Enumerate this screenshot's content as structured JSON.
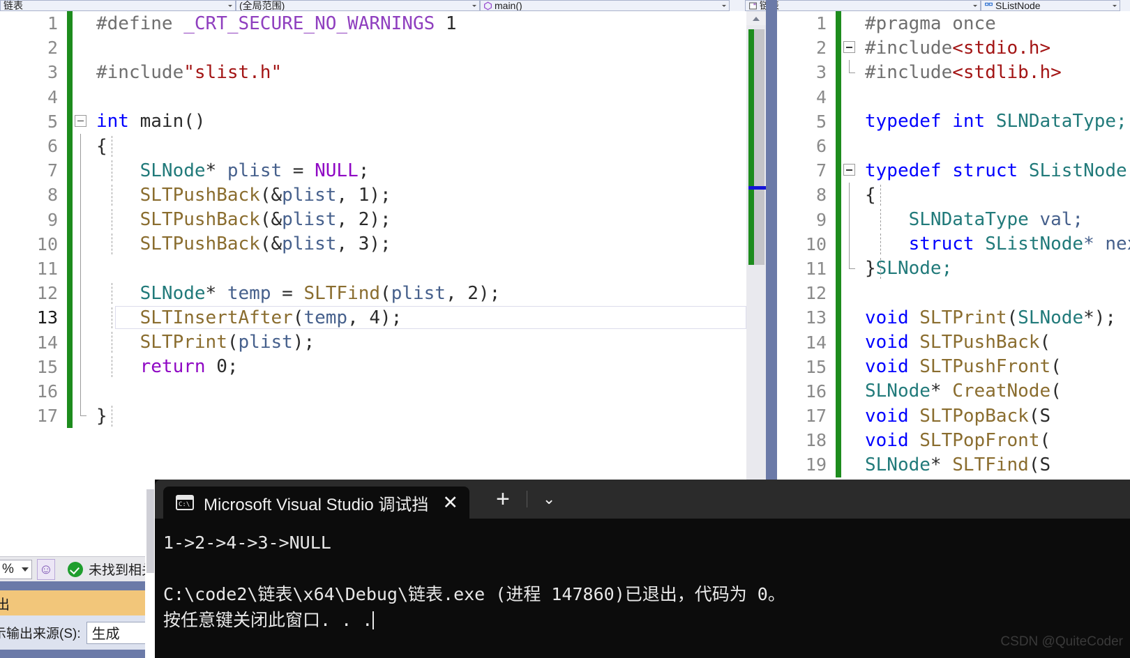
{
  "navbar": {
    "file_combo": {
      "label": "链表",
      "icon": "file-icon"
    },
    "scope_combo": {
      "label": "(全局范围)",
      "icon": "scope-icon"
    },
    "member_combo": {
      "label": "main()",
      "icon": "method-icon"
    },
    "right_file_combo": {
      "label": "链表",
      "icon": "file-icon"
    },
    "right_member_combo": {
      "label": "SListNode",
      "icon": "struct-icon"
    }
  },
  "left_editor": {
    "current_line": 13,
    "lines": [
      {
        "n": 1,
        "tokens": [
          {
            "t": "#define ",
            "c": "t-prep"
          },
          {
            "t": "_CRT_SECURE_NO_WARNINGS",
            "c": "t-macro"
          },
          {
            "t": " 1",
            "c": "t-num"
          }
        ]
      },
      {
        "n": 2,
        "tokens": []
      },
      {
        "n": 3,
        "tokens": [
          {
            "t": "#include",
            "c": "t-prep"
          },
          {
            "t": "\"slist.h\"",
            "c": "t-str"
          }
        ]
      },
      {
        "n": 4,
        "tokens": []
      },
      {
        "n": 5,
        "tokens": [
          {
            "t": "int",
            "c": "t-kw"
          },
          {
            "t": " ",
            "c": "t-plain"
          },
          {
            "t": "main",
            "c": "t-plain"
          },
          {
            "t": "()",
            "c": "t-punc"
          }
        ]
      },
      {
        "n": 6,
        "tokens": [
          {
            "t": "{",
            "c": "t-punc"
          }
        ]
      },
      {
        "n": 7,
        "tokens": [
          {
            "t": "    ",
            "c": "t-plain"
          },
          {
            "t": "SLNode",
            "c": "t-type"
          },
          {
            "t": "* ",
            "c": "t-punc"
          },
          {
            "t": "plist",
            "c": "t-var"
          },
          {
            "t": " = ",
            "c": "t-punc"
          },
          {
            "t": "NULL",
            "c": "t-kwp"
          },
          {
            "t": ";",
            "c": "t-punc"
          }
        ]
      },
      {
        "n": 8,
        "tokens": [
          {
            "t": "    ",
            "c": "t-plain"
          },
          {
            "t": "SLTPushBack",
            "c": "t-fn"
          },
          {
            "t": "(&",
            "c": "t-punc"
          },
          {
            "t": "plist",
            "c": "t-var"
          },
          {
            "t": ", ",
            "c": "t-punc"
          },
          {
            "t": "1",
            "c": "t-num"
          },
          {
            "t": ");",
            "c": "t-punc"
          }
        ]
      },
      {
        "n": 9,
        "tokens": [
          {
            "t": "    ",
            "c": "t-plain"
          },
          {
            "t": "SLTPushBack",
            "c": "t-fn"
          },
          {
            "t": "(&",
            "c": "t-punc"
          },
          {
            "t": "plist",
            "c": "t-var"
          },
          {
            "t": ", ",
            "c": "t-punc"
          },
          {
            "t": "2",
            "c": "t-num"
          },
          {
            "t": ");",
            "c": "t-punc"
          }
        ]
      },
      {
        "n": 10,
        "tokens": [
          {
            "t": "    ",
            "c": "t-plain"
          },
          {
            "t": "SLTPushBack",
            "c": "t-fn"
          },
          {
            "t": "(&",
            "c": "t-punc"
          },
          {
            "t": "plist",
            "c": "t-var"
          },
          {
            "t": ", ",
            "c": "t-punc"
          },
          {
            "t": "3",
            "c": "t-num"
          },
          {
            "t": ");",
            "c": "t-punc"
          }
        ]
      },
      {
        "n": 11,
        "tokens": []
      },
      {
        "n": 12,
        "tokens": [
          {
            "t": "    ",
            "c": "t-plain"
          },
          {
            "t": "SLNode",
            "c": "t-type"
          },
          {
            "t": "* ",
            "c": "t-punc"
          },
          {
            "t": "temp",
            "c": "t-var"
          },
          {
            "t": " = ",
            "c": "t-punc"
          },
          {
            "t": "SLTFind",
            "c": "t-fn"
          },
          {
            "t": "(",
            "c": "t-punc"
          },
          {
            "t": "plist",
            "c": "t-var"
          },
          {
            "t": ", ",
            "c": "t-punc"
          },
          {
            "t": "2",
            "c": "t-num"
          },
          {
            "t": ");",
            "c": "t-punc"
          }
        ]
      },
      {
        "n": 13,
        "tokens": [
          {
            "t": "    ",
            "c": "t-plain"
          },
          {
            "t": "SLTInsertAfter",
            "c": "t-fn"
          },
          {
            "t": "(",
            "c": "t-punc"
          },
          {
            "t": "temp",
            "c": "t-var"
          },
          {
            "t": ", ",
            "c": "t-punc"
          },
          {
            "t": "4",
            "c": "t-num"
          },
          {
            "t": ");",
            "c": "t-punc"
          }
        ]
      },
      {
        "n": 14,
        "tokens": [
          {
            "t": "    ",
            "c": "t-plain"
          },
          {
            "t": "SLTPrint",
            "c": "t-fn"
          },
          {
            "t": "(",
            "c": "t-punc"
          },
          {
            "t": "plist",
            "c": "t-var"
          },
          {
            "t": ");",
            "c": "t-punc"
          }
        ]
      },
      {
        "n": 15,
        "tokens": [
          {
            "t": "    ",
            "c": "t-plain"
          },
          {
            "t": "return",
            "c": "t-kwp"
          },
          {
            "t": " 0;",
            "c": "t-punc"
          }
        ]
      },
      {
        "n": 16,
        "tokens": []
      },
      {
        "n": 17,
        "tokens": [
          {
            "t": "}",
            "c": "t-punc"
          }
        ]
      }
    ]
  },
  "right_editor": {
    "lines": [
      {
        "n": 1,
        "tokens": [
          {
            "t": "#pragma once",
            "c": "t-prep"
          }
        ]
      },
      {
        "n": 2,
        "tokens": [
          {
            "t": "#include",
            "c": "t-prep"
          },
          {
            "t": "<stdio.h>",
            "c": "t-str"
          }
        ]
      },
      {
        "n": 3,
        "tokens": [
          {
            "t": "#include",
            "c": "t-prep"
          },
          {
            "t": "<stdlib.h>",
            "c": "t-str"
          }
        ]
      },
      {
        "n": 4,
        "tokens": []
      },
      {
        "n": 5,
        "tokens": [
          {
            "t": "typedef",
            "c": "t-kw"
          },
          {
            "t": " ",
            "c": "t-plain"
          },
          {
            "t": "int",
            "c": "t-kw"
          },
          {
            "t": " ",
            "c": "t-plain"
          },
          {
            "t": "SLNDataType;",
            "c": "t-type"
          }
        ]
      },
      {
        "n": 6,
        "tokens": []
      },
      {
        "n": 7,
        "tokens": [
          {
            "t": "typedef",
            "c": "t-kw"
          },
          {
            "t": " ",
            "c": "t-plain"
          },
          {
            "t": "struct",
            "c": "t-kw"
          },
          {
            "t": " ",
            "c": "t-plain"
          },
          {
            "t": "SListNode",
            "c": "t-type"
          }
        ]
      },
      {
        "n": 8,
        "tokens": [
          {
            "t": "{",
            "c": "t-punc"
          }
        ]
      },
      {
        "n": 9,
        "tokens": [
          {
            "t": "    ",
            "c": "t-plain"
          },
          {
            "t": "SLNDataType",
            "c": "t-type"
          },
          {
            "t": " val;",
            "c": "t-var"
          }
        ]
      },
      {
        "n": 10,
        "tokens": [
          {
            "t": "    ",
            "c": "t-plain"
          },
          {
            "t": "struct",
            "c": "t-kw"
          },
          {
            "t": " ",
            "c": "t-plain"
          },
          {
            "t": "SListNode",
            "c": "t-type"
          },
          {
            "t": "* next;",
            "c": "t-var"
          }
        ]
      },
      {
        "n": 11,
        "tokens": [
          {
            "t": "}",
            "c": "t-punc"
          },
          {
            "t": "SLNode;",
            "c": "t-type"
          }
        ]
      },
      {
        "n": 12,
        "tokens": []
      },
      {
        "n": 13,
        "tokens": [
          {
            "t": "void",
            "c": "t-kw"
          },
          {
            "t": " ",
            "c": "t-plain"
          },
          {
            "t": "SLTPrint",
            "c": "t-fn"
          },
          {
            "t": "(",
            "c": "t-punc"
          },
          {
            "t": "SLNode",
            "c": "t-type"
          },
          {
            "t": "*);",
            "c": "t-punc"
          }
        ]
      },
      {
        "n": 14,
        "tokens": [
          {
            "t": "void",
            "c": "t-kw"
          },
          {
            "t": " ",
            "c": "t-plain"
          },
          {
            "t": "SLTPushBack",
            "c": "t-fn"
          },
          {
            "t": "(",
            "c": "t-punc"
          }
        ]
      },
      {
        "n": 15,
        "tokens": [
          {
            "t": "void",
            "c": "t-kw"
          },
          {
            "t": " ",
            "c": "t-plain"
          },
          {
            "t": "SLTPushFront",
            "c": "t-fn"
          },
          {
            "t": "(",
            "c": "t-punc"
          }
        ]
      },
      {
        "n": 16,
        "tokens": [
          {
            "t": "SLNode",
            "c": "t-type"
          },
          {
            "t": "* ",
            "c": "t-punc"
          },
          {
            "t": "CreatNode",
            "c": "t-fn"
          },
          {
            "t": "(",
            "c": "t-punc"
          }
        ]
      },
      {
        "n": 17,
        "tokens": [
          {
            "t": "void",
            "c": "t-kw"
          },
          {
            "t": " ",
            "c": "t-plain"
          },
          {
            "t": "SLTPopBack",
            "c": "t-fn"
          },
          {
            "t": "(S",
            "c": "t-punc"
          }
        ]
      },
      {
        "n": 18,
        "tokens": [
          {
            "t": "void",
            "c": "t-kw"
          },
          {
            "t": " ",
            "c": "t-plain"
          },
          {
            "t": "SLTPopFront",
            "c": "t-fn"
          },
          {
            "t": "(",
            "c": "t-punc"
          }
        ]
      },
      {
        "n": 19,
        "tokens": [
          {
            "t": "SLNode",
            "c": "t-type"
          },
          {
            "t": "* ",
            "c": "t-punc"
          },
          {
            "t": "SLTFind",
            "c": "t-fn"
          },
          {
            "t": "(S",
            "c": "t-punc"
          }
        ]
      }
    ]
  },
  "status_bar": {
    "zoom_value": "%",
    "ai_icon": "ghost-icon",
    "result_icon": "success-check-icon",
    "result_text": "未找到相关",
    "output_tab_label": "出",
    "source_label": "示输出来源(S):",
    "source_value": "生成"
  },
  "console": {
    "tab_icon": "console-icon",
    "tab_title": "Microsoft Visual Studio 调试挡",
    "close_label": "✕",
    "new_tab_label": "+",
    "dropdown_label": "⌄",
    "output_line_1": "1->2->4->3->NULL",
    "output_line_2": "",
    "output_line_3": "C:\\code2\\链表\\x64\\Debug\\链表.exe (进程 147860)已退出，代码为 0。",
    "output_line_4": "按任意键关闭此窗口. . ."
  },
  "watermark": {
    "text": "CSDN @QuiteCoder"
  }
}
